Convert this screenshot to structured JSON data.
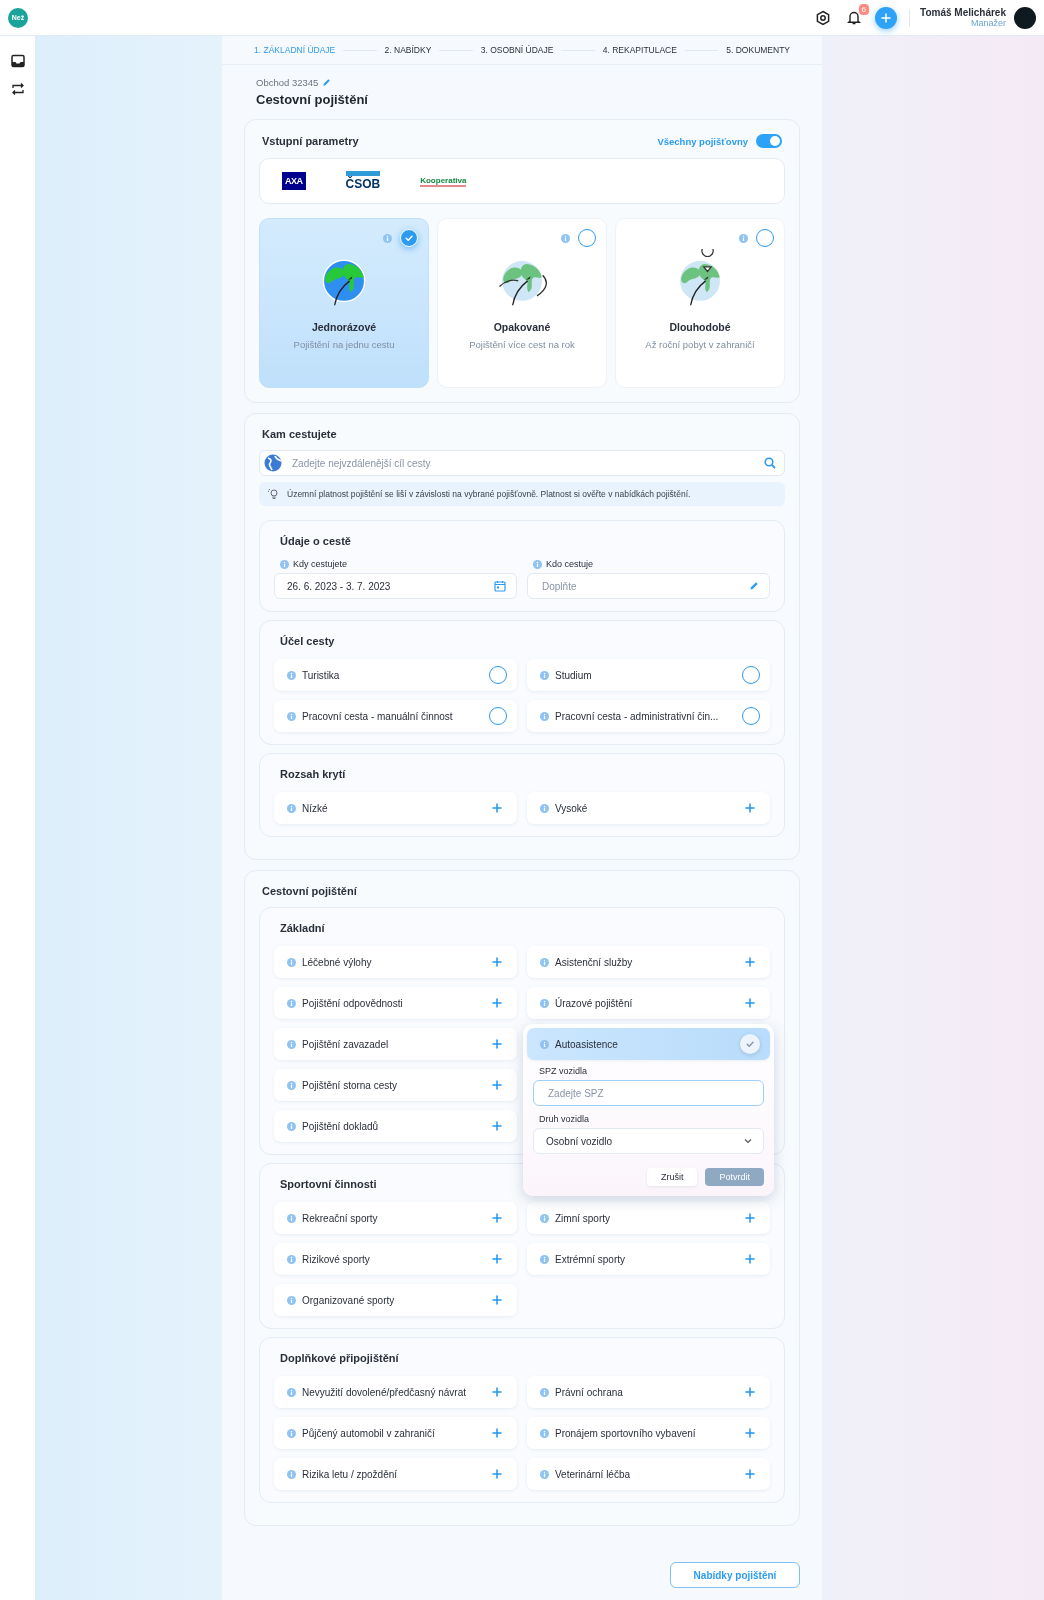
{
  "header": {
    "logo": "Než",
    "notifications": "6",
    "user_name": "Tomáš Melichárek",
    "user_role": "Manažer"
  },
  "steps": [
    {
      "label": "1. ZÁKLADNÍ ÚDAJE",
      "selected": true
    },
    {
      "label": "2. NABÍDKY",
      "selected": false
    },
    {
      "label": "3. OSOBNÍ ÚDAJE",
      "selected": false
    },
    {
      "label": "4. REKAPITULACE",
      "selected": false
    },
    {
      "label": "5. DOKUMENTY",
      "selected": false
    }
  ],
  "deal": "Obchod 32345",
  "page_title": "Cestovní pojištění",
  "parameters": {
    "title": "Vstupní parametry",
    "toggle_label": "Všechny pojišťovny",
    "toggle_on": true,
    "insurers": [
      {
        "name": "AXA",
        "kind": "axa"
      },
      {
        "name": "ČSOB",
        "kind": "csob"
      },
      {
        "name": "Kooperativa",
        "kind": "kooperativa"
      }
    ],
    "types": [
      {
        "title": "Jednorázové",
        "subtitle": "Pojištění na jednu cestu",
        "kind": "single",
        "selected": true
      },
      {
        "title": "Opakované",
        "subtitle": "Pojištění více cest na rok",
        "kind": "repeat",
        "selected": false
      },
      {
        "title": "Dlouhodobé",
        "subtitle": "Až roční pobyt v zahraničí",
        "kind": "long",
        "selected": false
      }
    ]
  },
  "destination": {
    "title": "Kam cestujete",
    "placeholder": "Zadejte nejvzdálenější cíl cesty",
    "notice": "Územní platnost pojištění se liší v závislosti na vybrané pojišťovně. Platnost si ověřte v nabídkách pojištění.",
    "trip": {
      "title": "Údaje o cestě",
      "fields": [
        {
          "label": "Kdy cestujete",
          "value": "26. 6. 2023 - 3. 7. 2023",
          "kind": "date"
        },
        {
          "label": "Kdo cestuje",
          "placeholder": "Doplňte",
          "kind": "edit"
        }
      ]
    },
    "purpose": {
      "title": "Účel cesty",
      "items": [
        {
          "label": "Turistika",
          "selected": false
        },
        {
          "label": "Studium",
          "selected": false
        },
        {
          "label": "Pracovní cesta - manuální činnost",
          "selected": false
        },
        {
          "label": "Pracovní cesta - administrativní čin...",
          "selected": false
        }
      ]
    },
    "coverage": {
      "title": "Rozsah krytí",
      "items": [
        {
          "label": "Nízké",
          "selected": false
        },
        {
          "label": "Vysoké",
          "selected": false
        }
      ]
    }
  },
  "insurance": {
    "title": "Cestovní pojištění",
    "groups": [
      {
        "title": "Základní",
        "items": [
          {
            "label": "Léčebné výlohy",
            "selected": false
          },
          {
            "label": "Asistenční služby",
            "selected": false
          },
          {
            "label": "Pojištění odpovědnosti",
            "selected": false
          },
          {
            "label": "Úrazové pojištění",
            "selected": false
          },
          {
            "label": "Pojištění zavazadel",
            "selected": false
          },
          {
            "label": "Autoasistence",
            "selected": true,
            "popup": {
              "fields": [
                {
                  "label": "SPZ vozidla",
                  "placeholder": "Zadejte SPZ",
                  "kind": "text"
                },
                {
                  "label": "Druh vozidla",
                  "value": "Osobní vozidlo",
                  "kind": "select"
                }
              ],
              "buttons": [
                {
                  "label": "Zrušit",
                  "kind": "secondary",
                  "disabled": false
                },
                {
                  "label": "Potvrdit",
                  "kind": "primary",
                  "disabled": true
                }
              ]
            }
          },
          {
            "label": "Pojištění storna cesty",
            "selected": false
          },
          {
            "label": "Pojištění dokladů",
            "selected": false
          }
        ]
      },
      {
        "title": "Sportovní činnosti",
        "items": [
          {
            "label": "Rekreační sporty",
            "selected": false
          },
          {
            "label": "Zimní sporty",
            "selected": false
          },
          {
            "label": "Rizikové sporty",
            "selected": false
          },
          {
            "label": "Extrémní sporty",
            "selected": false
          },
          {
            "label": "Organizované sporty",
            "selected": false
          }
        ]
      },
      {
        "title": "Doplňkové připojištění",
        "items": [
          {
            "label": "Nevyužití dovolené/předčasný návrat",
            "selected": false
          },
          {
            "label": "Právní ochrana",
            "selected": false
          },
          {
            "label": "Půjčený automobil v zahraničí",
            "selected": false
          },
          {
            "label": "Pronájem sportovního vybavení",
            "selected": false
          },
          {
            "label": "Rizika letu / zpoždění",
            "selected": false
          },
          {
            "label": "Veterinární léčba",
            "selected": false
          }
        ]
      }
    ]
  },
  "submit": "Nabídky pojištění"
}
